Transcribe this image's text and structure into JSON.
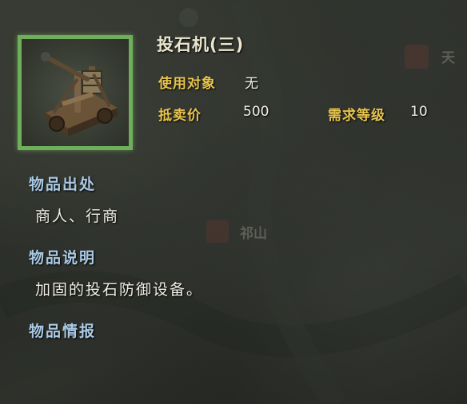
{
  "item": {
    "name": "投石机(三)",
    "icon": "catapult-icon",
    "target_label": "使用对象",
    "target_value": "无",
    "price_label": "抵卖价",
    "price_value": "500",
    "level_label": "需求等级",
    "level_value": "10"
  },
  "sections": {
    "source_title": "物品出处",
    "source_text": "商人、行商",
    "desc_title": "物品说明",
    "desc_text": "加固的投石防御设备。",
    "info_title": "物品情报"
  },
  "background": {
    "map_label_1": "天",
    "map_label_2": "祁山"
  },
  "colors": {
    "frame_green": "#6fae5a",
    "label_gold": "#e8c44e",
    "section_blue": "#a9c9e4",
    "text_white": "#f0eee6"
  }
}
